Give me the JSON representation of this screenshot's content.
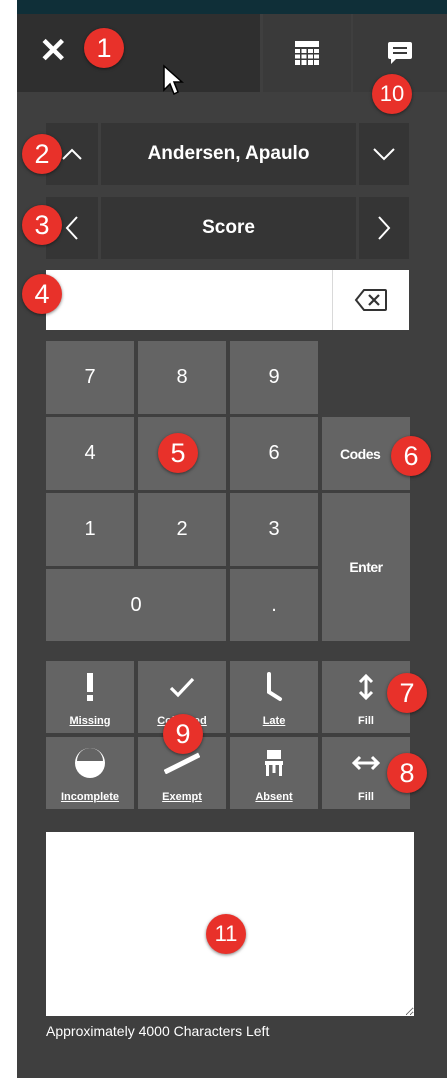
{
  "header": {
    "close_glyph": "✕"
  },
  "student_nav": {
    "name": "Andersen, Apaulo"
  },
  "column_nav": {
    "label": "Score"
  },
  "score_input": {
    "value": ""
  },
  "keypad": {
    "keys": {
      "k7": "7",
      "k8": "8",
      "k9": "9",
      "k4": "4",
      "k5": "5",
      "k6": "6",
      "k1": "1",
      "k2": "2",
      "k3": "3",
      "k0": "0",
      "dot": ".",
      "codes": "Codes",
      "enter": "Enter"
    }
  },
  "quick_buttons": {
    "missing": "Missing",
    "collected": "Collected",
    "late": "Late",
    "fill_vertical": "Fill",
    "incomplete": "Incomplete",
    "exempt": "Exempt",
    "absent": "Absent",
    "fill_horizontal": "Fill"
  },
  "comment": {
    "value": "",
    "chars_left": "Approximately 4000 Characters Left"
  },
  "callouts": [
    "1",
    "2",
    "3",
    "4",
    "5",
    "6",
    "7",
    "8",
    "9",
    "10",
    "11"
  ],
  "colors": {
    "panel": "#3f3f3f",
    "key": "#646464",
    "callout": "#e8312a",
    "top_strip": "#0f2f38"
  }
}
